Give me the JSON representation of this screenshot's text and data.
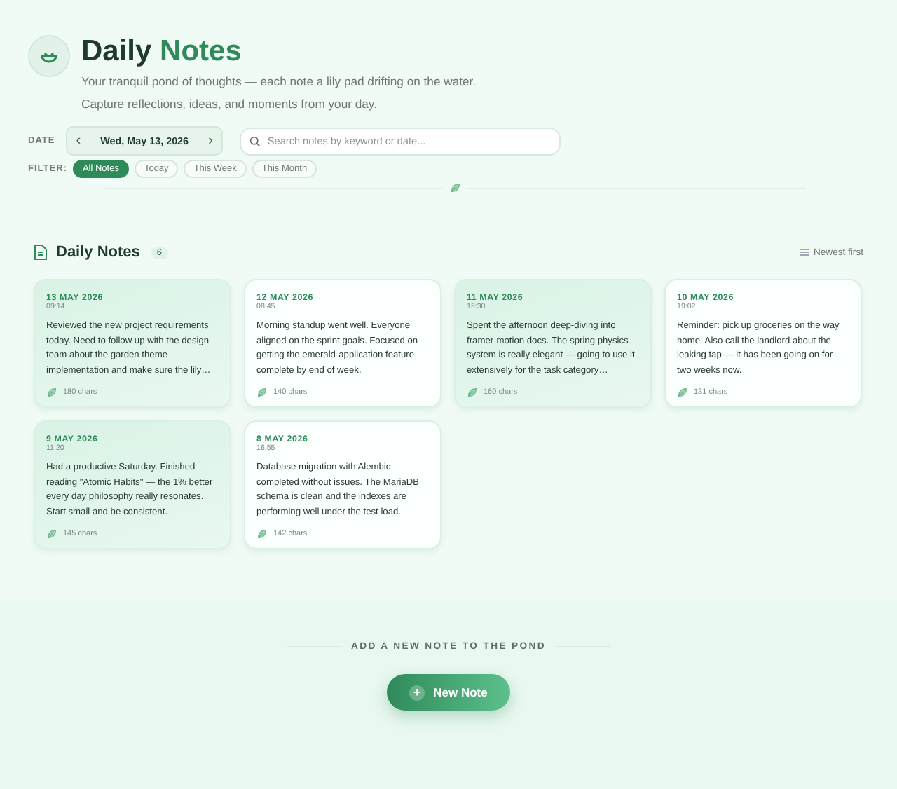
{
  "header": {
    "title_main": "Daily",
    "title_accent": "Notes",
    "subtitle_lines": [
      "Your tranquil pond of thoughts — each note a lily pad drifting on the water.",
      "Capture reflections, ideas, and moments from your day."
    ]
  },
  "date_picker": {
    "label": "DATE",
    "prev": "‹",
    "value": "Wed, May 13, 2026",
    "next": "›"
  },
  "search": {
    "placeholder": "Search notes by keyword or date..."
  },
  "filters": {
    "label": "FILTER:",
    "items": [
      {
        "label": "All Notes",
        "selected": true
      },
      {
        "label": "Today",
        "selected": false
      },
      {
        "label": "This Week",
        "selected": false
      },
      {
        "label": "This Month",
        "selected": false
      }
    ]
  },
  "section": {
    "title": "Daily Notes",
    "count": "6",
    "sort": "Newest first"
  },
  "notes": [
    {
      "date": "13 MAY 2026",
      "time": "09:14",
      "text": "Reviewed the new project requirements today. Need to follow up with the design team about the garden theme implementation and make sure the lily…",
      "chars": "180 chars",
      "highlighted": true
    },
    {
      "date": "12 MAY 2026",
      "time": "08:45",
      "text": "Morning standup went well. Everyone aligned on the sprint goals. Focused on getting the emerald-application feature complete by end of week.",
      "chars": "140 chars",
      "highlighted": false
    },
    {
      "date": "11 MAY 2026",
      "time": "15:30",
      "text": "Spent the afternoon deep-diving into framer-motion docs. The spring physics system is really elegant — going to use it extensively for the task category…",
      "chars": "160 chars",
      "highlighted": true
    },
    {
      "date": "10 MAY 2026",
      "time": "19:02",
      "text": "Reminder: pick up groceries on the way home. Also call the landlord about the leaking tap — it has been going on for two weeks now.",
      "chars": "131 chars",
      "highlighted": false
    },
    {
      "date": "9 MAY 2026",
      "time": "11:20",
      "text": "Had a productive Saturday. Finished reading \"Atomic Habits\" — the 1% better every day philosophy really resonates. Start small and be consistent.",
      "chars": "145 chars",
      "highlighted": true
    },
    {
      "date": "8 MAY 2026",
      "time": "16:55",
      "text": "Database migration with Alembic completed without issues. The MariaDB schema is clean and the indexes are performing well under the test load.",
      "chars": "142 chars",
      "highlighted": false
    }
  ],
  "footer": {
    "caption": "ADD A NEW NOTE TO THE POND",
    "button": {
      "icon": "+",
      "label": "New Note"
    }
  }
}
